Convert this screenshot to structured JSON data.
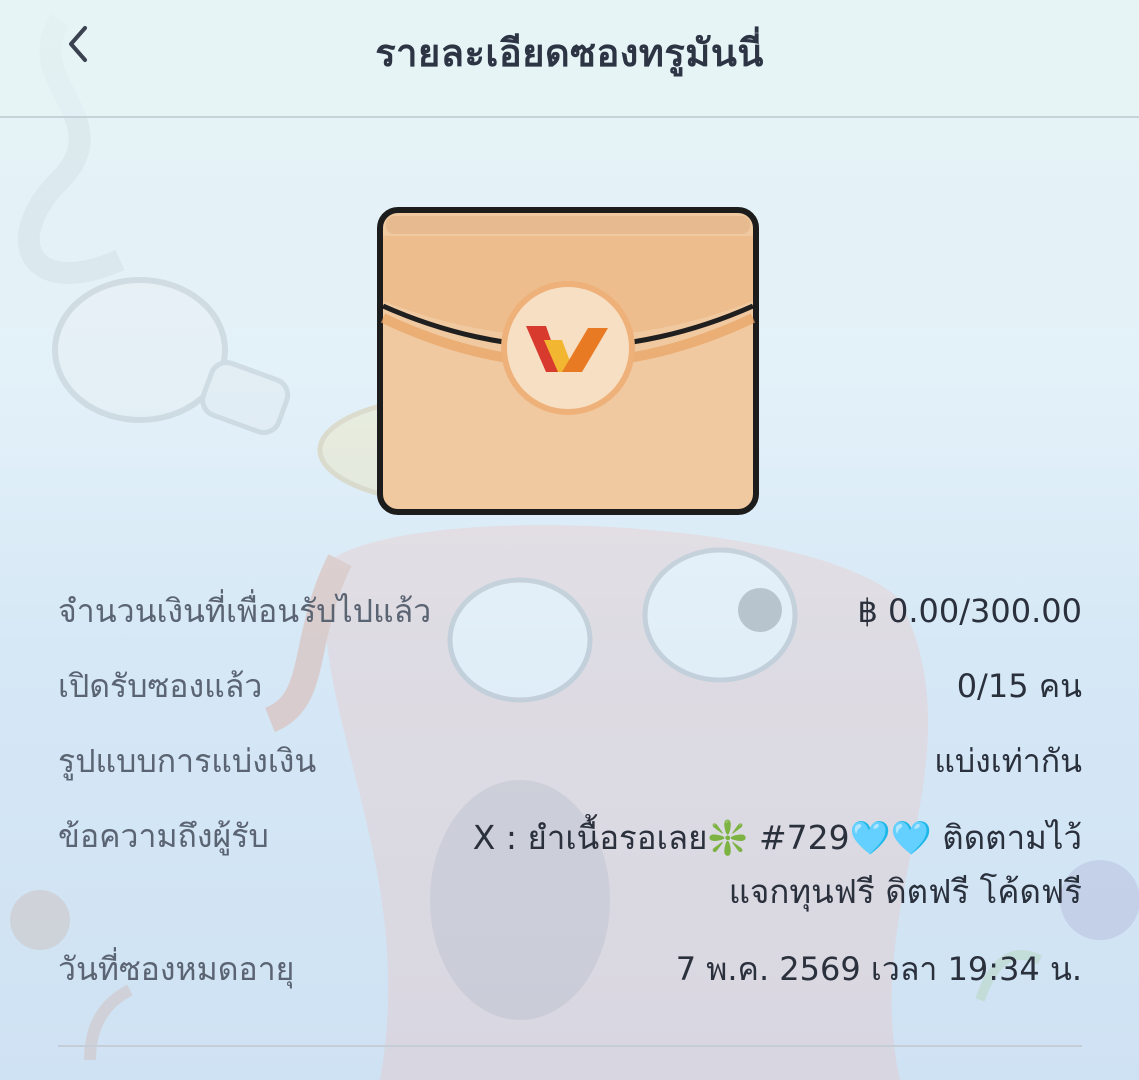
{
  "header": {
    "title": "รายละเอียดซองทรูมันนี่",
    "back_icon": "chevron-left-icon"
  },
  "envelope": {
    "icon": "envelope-icon",
    "logo": "truemoney-wallet-logo",
    "colors": {
      "body": "#f0c9a0",
      "flap": "#e8a86a",
      "seal": "#f7dfc4",
      "outline": "#1c1c1c"
    }
  },
  "details": {
    "amount": {
      "label": "จำนวนเงินที่เพื่อนรับไปแล้ว",
      "value": "฿ 0.00/300.00"
    },
    "opened": {
      "label": "เปิดรับซองแล้ว",
      "value": "0/15 คน"
    },
    "split": {
      "label": "รูปแบบการแบ่งเงิน",
      "value": "แบ่งเท่ากัน"
    },
    "message": {
      "label": "ข้อความถึงผู้รับ",
      "line1": "X : ยำเนื้อรอเลย❇️ #729🩵🩵 ติดตามไว้",
      "line2": "แจกทุนฟรี ดิตฟรี โค้ดฟรี"
    },
    "expiry": {
      "label": "วันที่ซองหมดอายุ",
      "value": "7 พ.ค. 2569 เวลา 19:34 น."
    }
  }
}
